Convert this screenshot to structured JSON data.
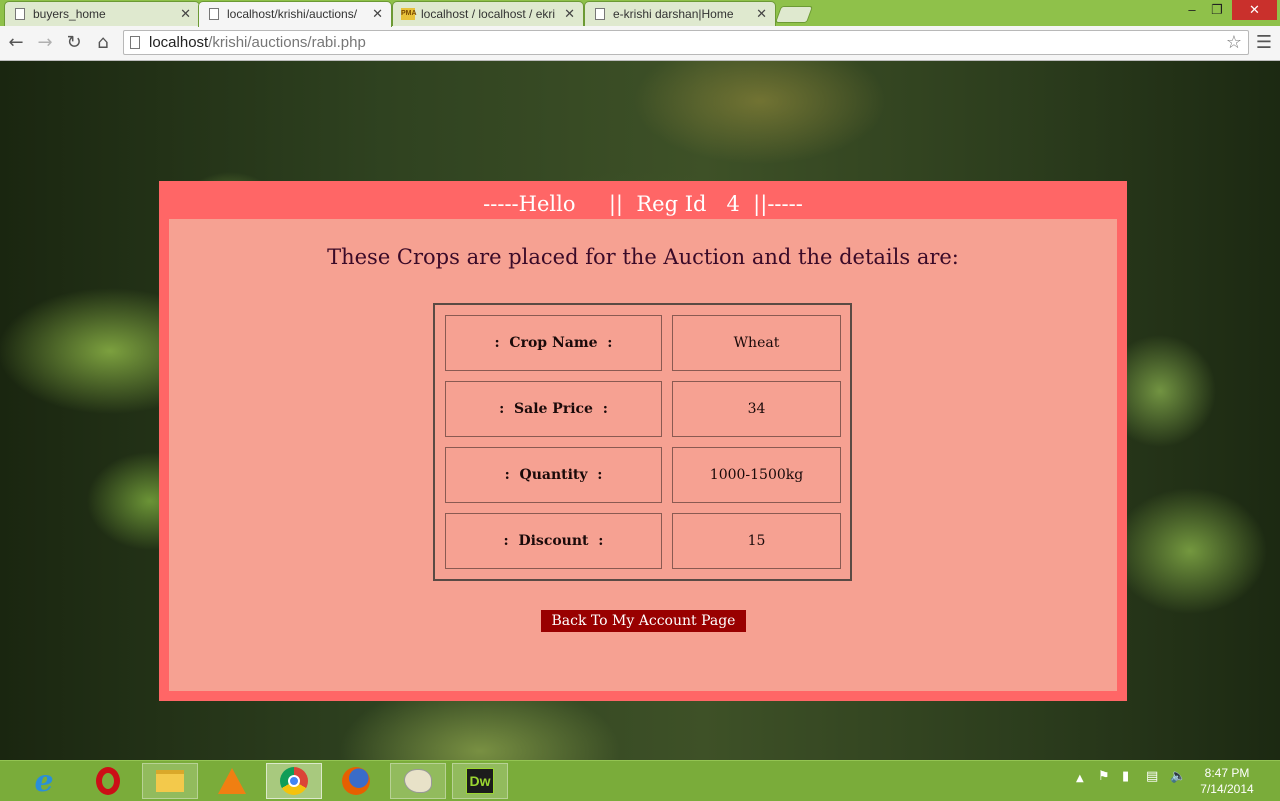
{
  "browser": {
    "tabs": [
      {
        "title": "buyers_home",
        "icon": "page-icon",
        "active": false
      },
      {
        "title": "localhost/krishi/auctions/",
        "icon": "page-icon",
        "active": true
      },
      {
        "title": "localhost / localhost / ekri",
        "icon": "phpmyadmin-icon",
        "active": false
      },
      {
        "title": "e-krishi darshan|Home",
        "icon": "page-icon",
        "active": false
      }
    ],
    "address": {
      "host": "localhost",
      "path": "/krishi/auctions/rabi.php"
    },
    "window_controls": {
      "minimize": "‒",
      "restore": "❐",
      "close": "✕"
    }
  },
  "page": {
    "header": "-----Hello     ||  Reg Id   4  ||-----",
    "intro": "These Crops are placed for the Auction and the details are:",
    "details": [
      {
        "label": " :  Crop Name  : ",
        "value": "Wheat"
      },
      {
        "label": " :  Sale Price  : ",
        "value": "34"
      },
      {
        "label": " :  Quantity  : ",
        "value": "1000-1500kg"
      },
      {
        "label": " :  Discount  : ",
        "value": "15"
      }
    ],
    "back_button": "Back To My Account Page",
    "colors": {
      "panel": "#ff6666",
      "inner": "#f6a192",
      "button": "#990000"
    }
  },
  "taskbar": {
    "apps": [
      "internet-explorer",
      "opera",
      "file-explorer",
      "vlc",
      "chrome",
      "firefox",
      "paint",
      "dreamweaver"
    ],
    "dreamweaver_label": "Dw",
    "time": "8:47 PM",
    "date": "7/14/2014"
  }
}
